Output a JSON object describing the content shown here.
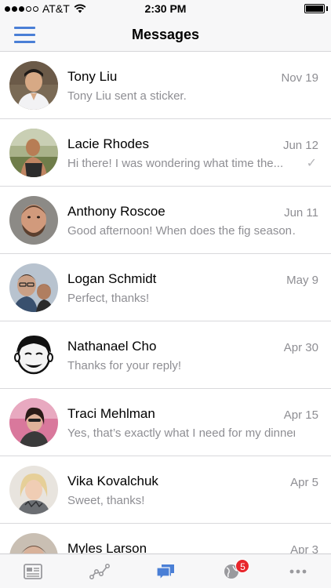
{
  "status_bar": {
    "carrier": "AT&T",
    "time": "2:30 PM",
    "signal_bars_filled": 3,
    "signal_bars_total": 5,
    "battery_level": 1.0
  },
  "nav": {
    "title": "Messages",
    "menu_icon": "hamburger-menu-icon",
    "accent_color": "#4a7fd6"
  },
  "conversations": [
    {
      "name": "Tony Liu",
      "preview": "Tony Liu sent a sticker.",
      "date": "Nov 19",
      "check": ""
    },
    {
      "name": "Lacie Rhodes",
      "preview": "Hi there! I was wondering what time the...",
      "date": "Jun 12",
      "check": "✓"
    },
    {
      "name": "Anthony Roscoe",
      "preview": "Good afternoon! When does the fig season…",
      "date": "Jun 11",
      "check": ""
    },
    {
      "name": "Logan Schmidt",
      "preview": "Perfect, thanks!",
      "date": "May 9",
      "check": ""
    },
    {
      "name": "Nathanael Cho",
      "preview": "Thanks for your reply!",
      "date": "Apr 30",
      "check": ""
    },
    {
      "name": "Traci Mehlman",
      "preview": "Yes, that’s exactly what I need for my dinner…",
      "date": "Apr 15",
      "check": ""
    },
    {
      "name": "Vika Kovalchuk",
      "preview": "Sweet, thanks!",
      "date": "Apr 5",
      "check": ""
    },
    {
      "name": "Myles Larson",
      "preview": "",
      "date": "Apr 3",
      "check": ""
    }
  ],
  "tabs": [
    {
      "icon": "page-icon",
      "active": false
    },
    {
      "icon": "insights-icon",
      "active": false
    },
    {
      "icon": "messages-icon",
      "active": true
    },
    {
      "icon": "notifications-globe-icon",
      "active": false,
      "badge": "5"
    },
    {
      "icon": "more-icon",
      "active": false
    }
  ],
  "colors": {
    "active_tab": "#4a7fd6",
    "inactive_tab": "#9a9a9e",
    "badge": "#e8262c"
  }
}
